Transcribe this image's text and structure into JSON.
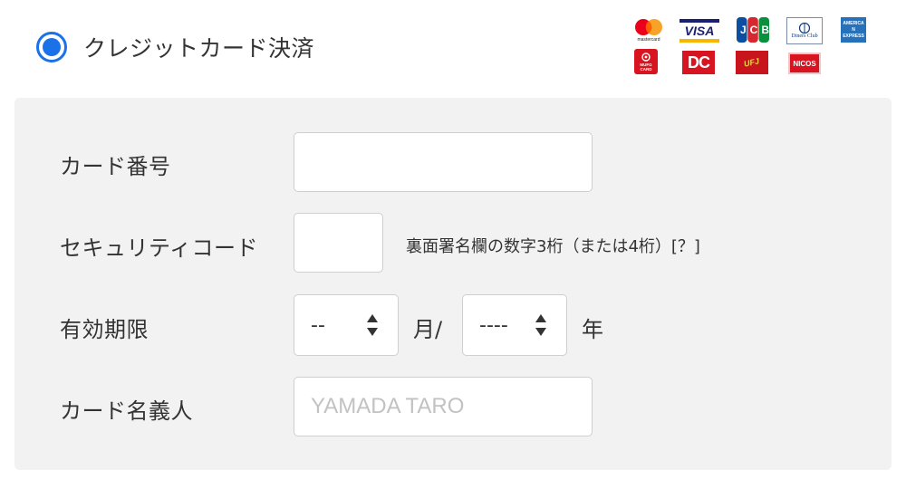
{
  "payment_method": {
    "label": "クレジットカード決済",
    "selected": true
  },
  "brands": [
    {
      "name": "mastercard",
      "text": "mastercard"
    },
    {
      "name": "visa",
      "text": "VISA"
    },
    {
      "name": "jcb",
      "text": "JCB"
    },
    {
      "name": "diners",
      "text": "Diners Club"
    },
    {
      "name": "amex",
      "text": "AMERICAN EXPRESS"
    },
    {
      "name": "mufg",
      "text": "MUFG CARD"
    },
    {
      "name": "dc",
      "text": "DC"
    },
    {
      "name": "ufj",
      "text": "UFJ"
    },
    {
      "name": "nicos",
      "text": "NICOS"
    }
  ],
  "form": {
    "card_number_label": "カード番号",
    "card_number_value": "",
    "security_code_label": "セキュリティコード",
    "security_code_value": "",
    "security_code_hint": "裏面署名欄の数字3桁（または4桁）[？]",
    "expiry_label": "有効期限",
    "expiry_month_value": "--",
    "month_unit": "月/",
    "expiry_year_value": "----",
    "year_unit": "年",
    "holder_label": "カード名義人",
    "holder_placeholder": "YAMADA TARO"
  },
  "colors": {
    "accent": "#1b72e8",
    "panel_bg": "#f2f2f2",
    "field_border": "#cfcfcf",
    "placeholder": "#c2c2c2"
  }
}
